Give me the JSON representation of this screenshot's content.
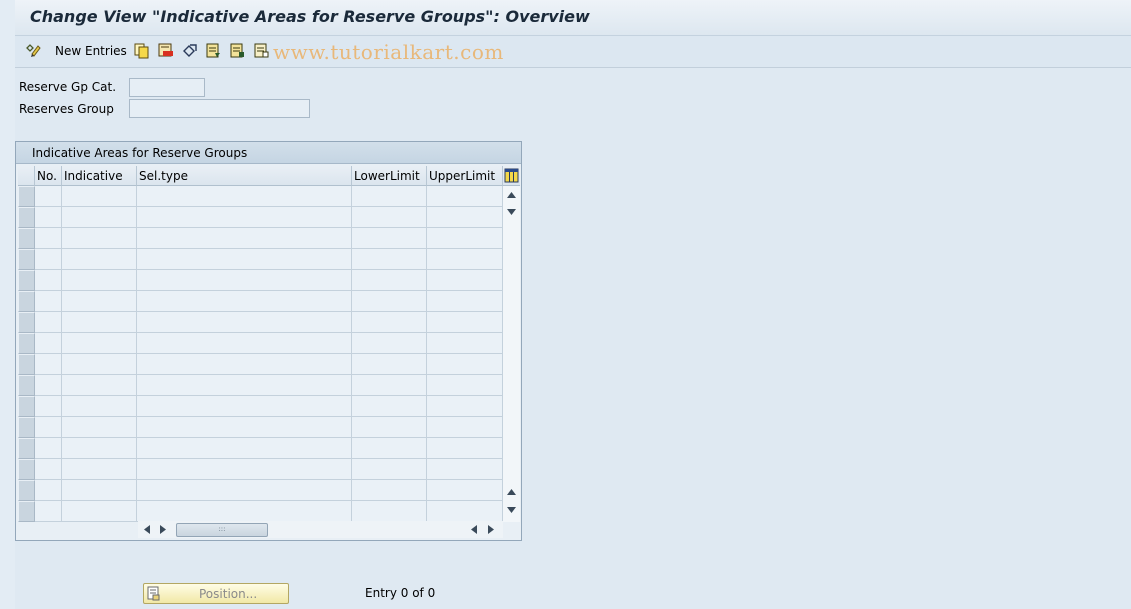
{
  "title": "Change View \"Indicative Areas for Reserve Groups\": Overview",
  "toolbar": {
    "new_entries_label": "New Entries",
    "watermark": "www.tutorialkart.com",
    "icons": [
      "glasses-edit-icon",
      "copy-icon",
      "delete-icon",
      "undo-icon",
      "select-all-icon",
      "select-block-icon",
      "deselect-all-icon"
    ]
  },
  "fields": {
    "reserve_gp_cat": {
      "label": "Reserve Gp Cat.",
      "value": ""
    },
    "reserves_group": {
      "label": "Reserves Group",
      "value": ""
    }
  },
  "table": {
    "title": "Indicative Areas for Reserve Groups",
    "columns": [
      "No.",
      "Indicative",
      "Sel.type",
      "LowerLimit",
      "UpperLimit"
    ],
    "rows": []
  },
  "footer": {
    "position_label": "Position...",
    "entry_info": "Entry 0 of 0"
  }
}
